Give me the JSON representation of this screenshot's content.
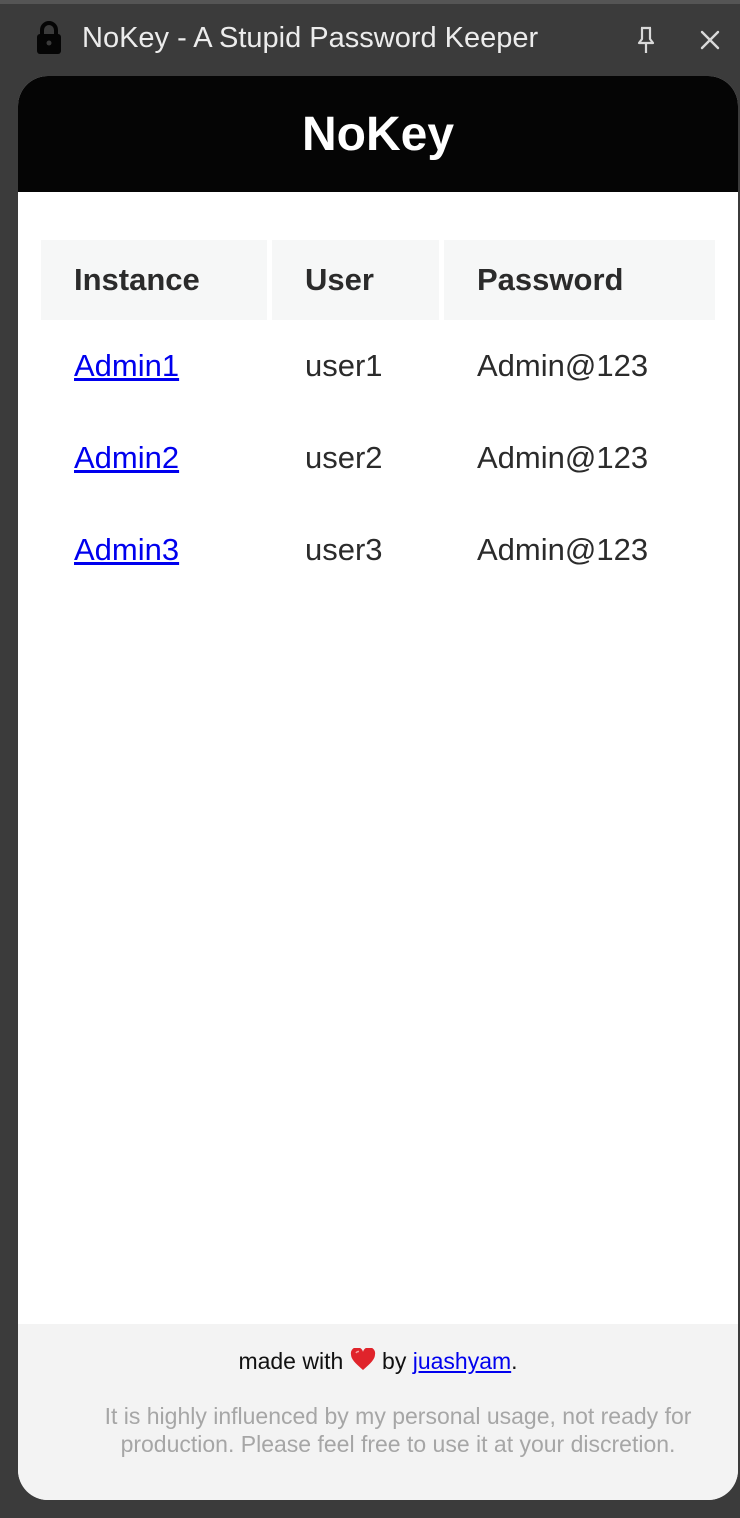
{
  "window": {
    "title": "NoKey - A Stupid Password Keeper",
    "icons": {
      "lock": "lock-icon",
      "pin": "pin-icon",
      "close": "close-icon"
    }
  },
  "app": {
    "title": "NoKey",
    "header_bg": "#050505"
  },
  "table": {
    "headers": [
      "Instance",
      "User",
      "Password"
    ],
    "rows": [
      {
        "instance": "Admin1",
        "user": "user1",
        "password": "Admin@123"
      },
      {
        "instance": "Admin2",
        "user": "user2",
        "password": "Admin@123"
      },
      {
        "instance": "Admin3",
        "user": "user3",
        "password": "Admin@123"
      }
    ]
  },
  "footer": {
    "made_with": "made with",
    "heart": "heart-icon",
    "by": "by",
    "author": "juashyam",
    "period": ".",
    "disclaimer": "It is highly influenced by my personal usage, not ready for production. Please feel free to use it at your discretion."
  },
  "colors": {
    "link": "#0000ee",
    "heart": "#e0242b"
  }
}
